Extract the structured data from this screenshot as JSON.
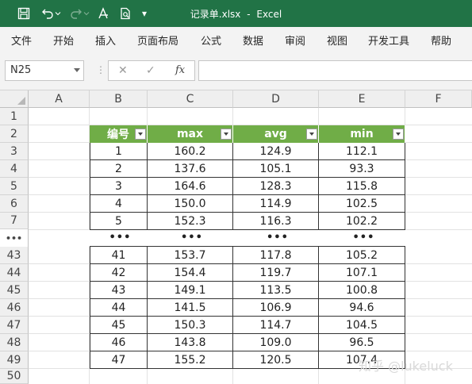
{
  "titlebar": {
    "filename": "记录单.xlsx",
    "separator": "-",
    "app_name": "Excel",
    "more": "▾"
  },
  "ribbon": {
    "tabs": [
      "文件",
      "开始",
      "插入",
      "页面布局",
      "公式",
      "数据",
      "审阅",
      "视图",
      "开发工具",
      "帮助"
    ]
  },
  "formula_bar": {
    "name_box": "N25",
    "separator": "⋮",
    "cancel": "✕",
    "enter": "✓",
    "fx": "fx",
    "formula": ""
  },
  "grid": {
    "columns": [
      "A",
      "B",
      "C",
      "D",
      "E",
      "F"
    ],
    "top_rows": [
      "1",
      "2",
      "3",
      "4",
      "5",
      "6",
      "7"
    ],
    "skip_marker": "•••",
    "bottom_rows": [
      "43",
      "44",
      "45",
      "46",
      "47",
      "48",
      "49",
      "50"
    ]
  },
  "table": {
    "headers": [
      "编号",
      "max",
      "avg",
      "min"
    ],
    "top_rows": [
      [
        "1",
        "160.2",
        "124.9",
        "112.1"
      ],
      [
        "2",
        "137.6",
        "105.1",
        "93.3"
      ],
      [
        "3",
        "164.6",
        "128.3",
        "115.8"
      ],
      [
        "4",
        "150.0",
        "114.9",
        "102.5"
      ],
      [
        "5",
        "152.3",
        "116.3",
        "102.2"
      ]
    ],
    "ellipsis": [
      "•••",
      "•••",
      "•••",
      "•••"
    ],
    "bottom_rows": [
      [
        "41",
        "153.7",
        "117.8",
        "105.2"
      ],
      [
        "42",
        "154.4",
        "119.7",
        "107.1"
      ],
      [
        "43",
        "149.1",
        "113.5",
        "100.8"
      ],
      [
        "44",
        "141.5",
        "106.9",
        "94.6"
      ],
      [
        "45",
        "150.3",
        "114.7",
        "104.5"
      ],
      [
        "46",
        "143.8",
        "109.0",
        "96.5"
      ],
      [
        "47",
        "155.2",
        "120.5",
        "107.4"
      ]
    ]
  },
  "watermark": "知乎 @lukeluck",
  "colors": {
    "excel_green": "#217346",
    "table_header_green": "#70ad47"
  }
}
